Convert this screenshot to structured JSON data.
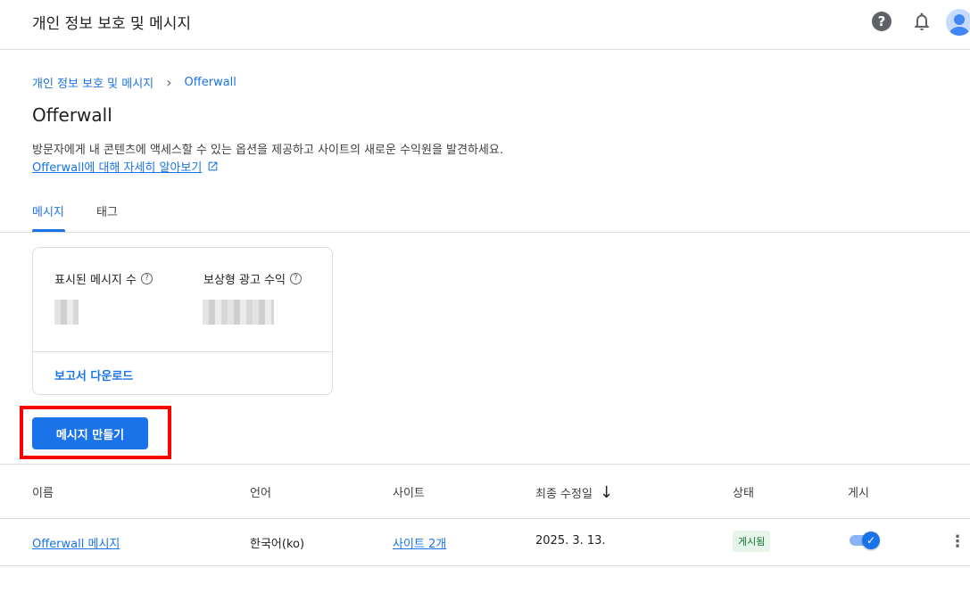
{
  "header": {
    "title": "개인 정보 보호 및 메시지",
    "help_icon": "help-icon",
    "help_glyph": "?",
    "bell_icon": "bell-icon",
    "avatar_icon": "avatar-icon"
  },
  "breadcrumb": {
    "parent": "개인 정보 보호 및 메시지",
    "separator": "›",
    "current": "Offerwall"
  },
  "page": {
    "title": "Offerwall",
    "description": "방문자에게 내 콘텐츠에 액세스할 수 있는 옵션을 제공하고 사이트의 새로운 수익원을 발견하세요.",
    "learn_more": "Offerwall에 대해 자세히 알아보기"
  },
  "tabs": [
    {
      "label": "메시지",
      "active": true
    },
    {
      "label": "태그",
      "active": false
    }
  ],
  "stats": {
    "messages_shown_label": "표시된 메시지 수",
    "rewarded_revenue_label": "보상형 광고 수익",
    "info_glyph": "?",
    "download_label": "보고서 다운로드"
  },
  "create_button": "메시지 만들기",
  "table": {
    "columns": [
      "이름",
      "언어",
      "사이트",
      "최종 수정일",
      "상태",
      "게시"
    ],
    "sort_icon": "↓",
    "rows": [
      {
        "name": "Offerwall 메시지",
        "language": "한국어(ko)",
        "sites": "사이트 2개",
        "modified": "2025. 3. 13.",
        "status": "게시됨",
        "published": true,
        "check_glyph": "✓",
        "more_glyph": "⋮"
      }
    ]
  },
  "colors": {
    "accent": "#1a73e8",
    "highlight": "#ff0000",
    "status_bg": "#e6f4ea",
    "status_text": "#137333"
  }
}
